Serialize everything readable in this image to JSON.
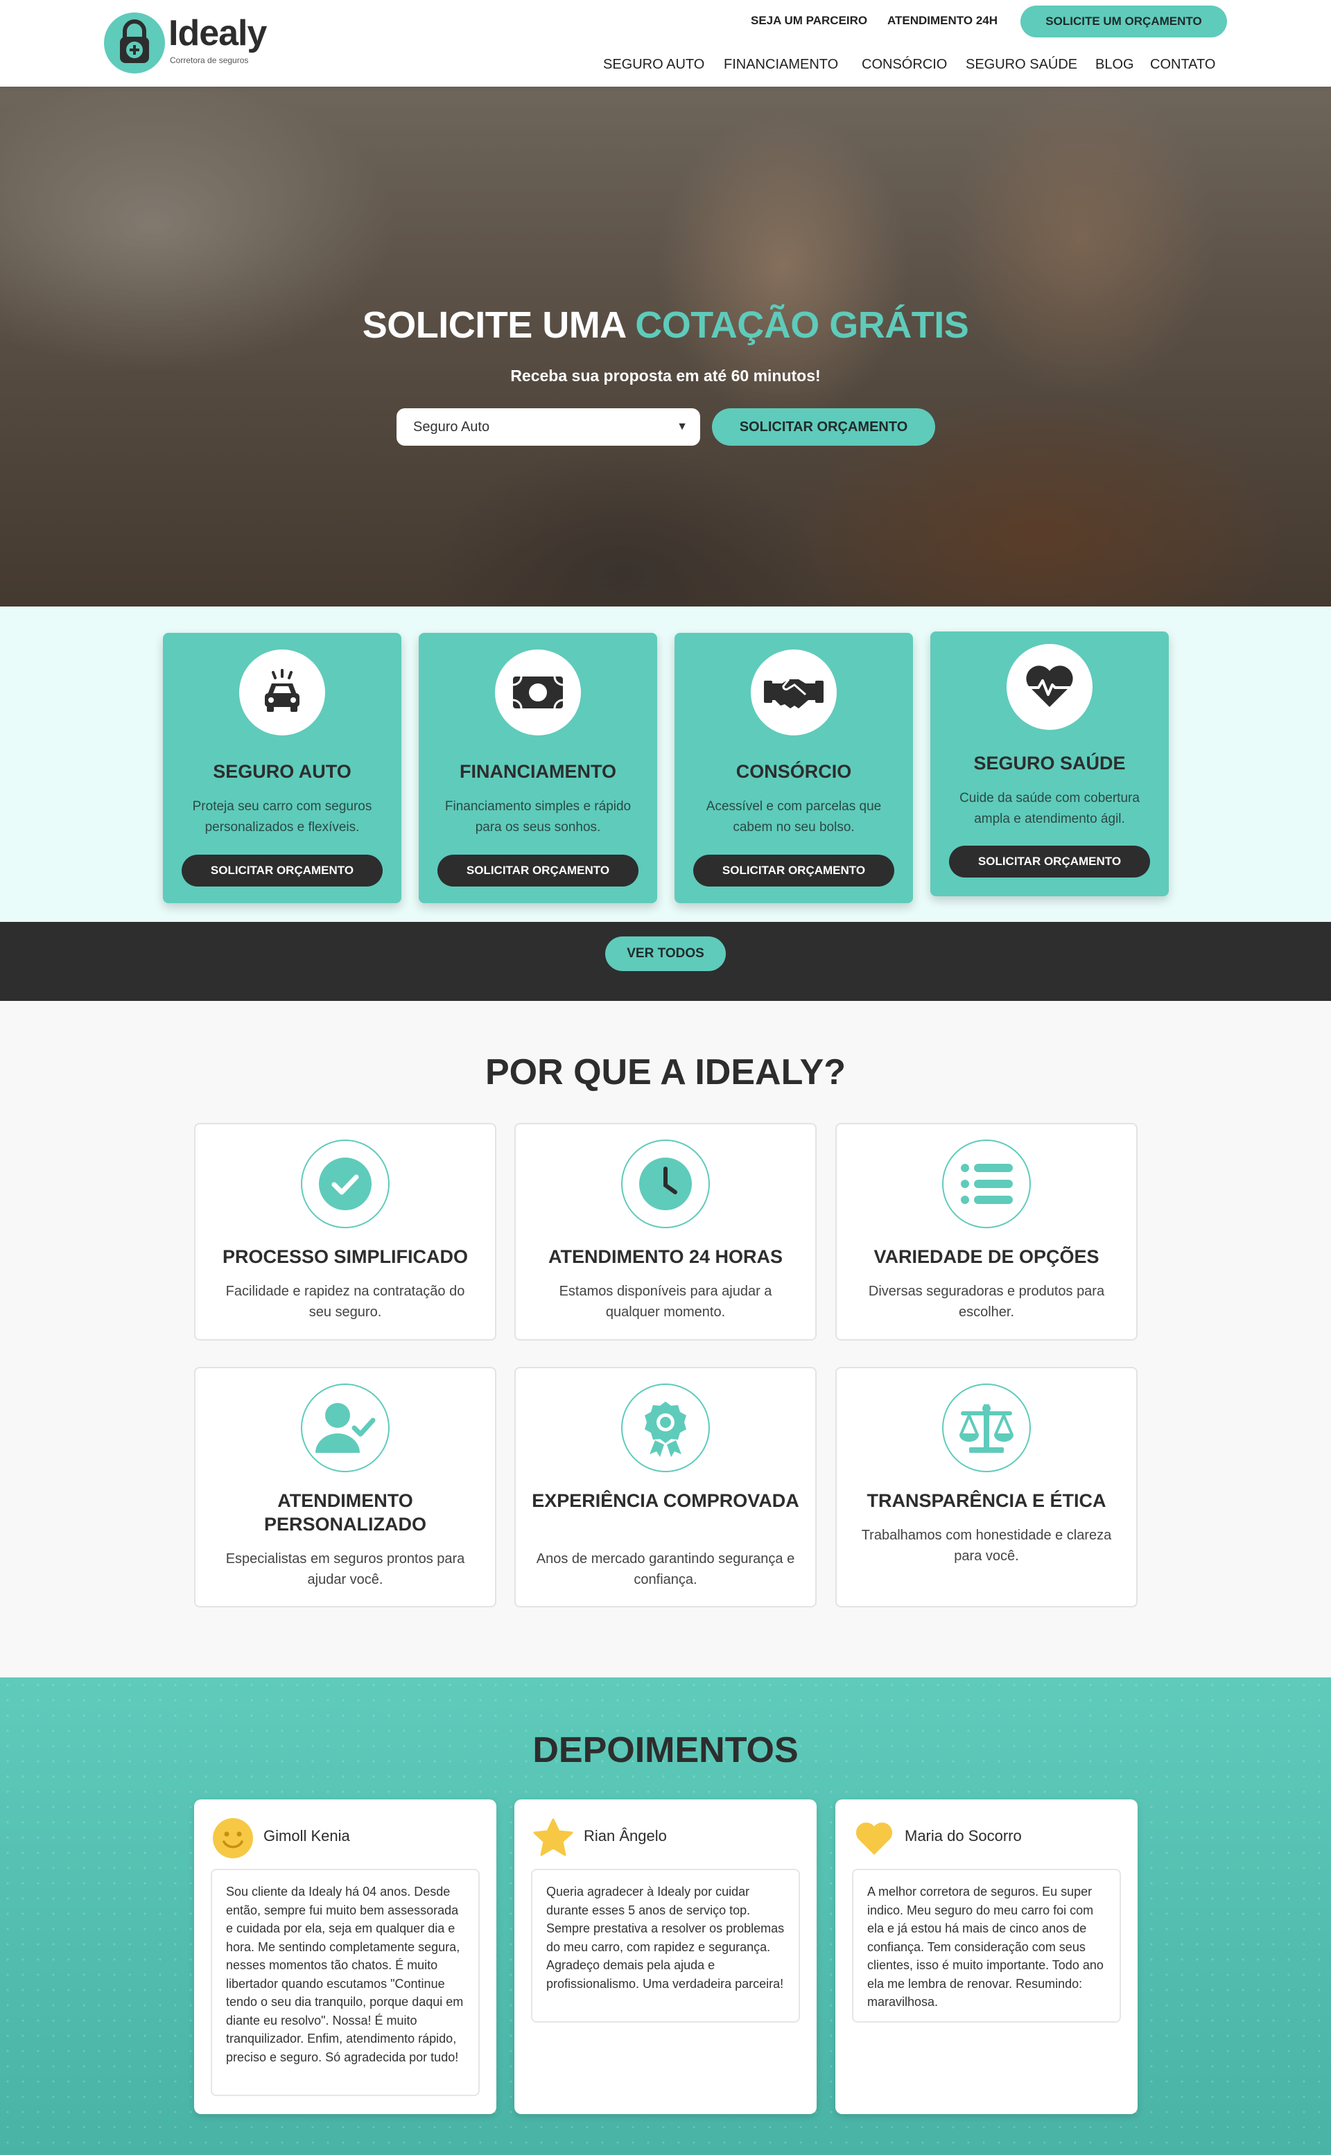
{
  "brand": {
    "name": "Idealy",
    "tagline": "Corretora de seguros"
  },
  "header": {
    "top_links": [
      "SEJA UM PARCEIRO",
      "ATENDIMENTO 24H"
    ],
    "cta_label": "SOLICITE UM ORÇAMENTO",
    "nav": [
      "SEGURO AUTO",
      "FINANCIAMENTO",
      "CONSÓRCIO",
      "SEGURO SAÚDE",
      "BLOG",
      "CONTATO"
    ]
  },
  "hero": {
    "title_part1": "SOLICITE UMA ",
    "title_accent": "COTAÇÃO GRÁTIS",
    "subtitle": "Receba sua proposta em até 60 minutos!",
    "select_value": "Seguro Auto",
    "button_label": "SOLICITAR ORÇAMENTO"
  },
  "services": {
    "items": [
      {
        "title": "SEGURO AUTO",
        "desc": "Proteja seu carro com seguros personalizados e flexíveis.",
        "button": "SOLICITAR ORÇAMENTO",
        "icon": "car-icon"
      },
      {
        "title": "FINANCIAMENTO",
        "desc": "Financiamento simples e rápido para os seus sonhos.",
        "button": "SOLICITAR ORÇAMENTO",
        "icon": "money-bill-icon"
      },
      {
        "title": "CONSÓRCIO",
        "desc": "Acessível e com parcelas que cabem no seu bolso.",
        "button": "SOLICITAR ORÇAMENTO",
        "icon": "handshake-icon"
      },
      {
        "title": "SEGURO SAÚDE",
        "desc": "Cuide da saúde com cobertura ampla e atendimento ágil.",
        "button": "SOLICITAR ORÇAMENTO",
        "icon": "heart-pulse-icon"
      }
    ],
    "see_all_label": "VER TODOS"
  },
  "why": {
    "title": "POR QUE A IDEALY?",
    "items": [
      {
        "title": "PROCESSO SIMPLIFICADO",
        "desc": "Facilidade e rapidez na contratação do seu seguro.",
        "icon": "check-circle-icon"
      },
      {
        "title": "ATENDIMENTO 24 HORAS",
        "desc": "Estamos disponíveis para ajudar a qualquer momento.",
        "icon": "clock-icon"
      },
      {
        "title": "VARIEDADE DE OPÇÕES",
        "desc": "Diversas seguradoras e produtos para escolher.",
        "icon": "list-icon"
      },
      {
        "title": "ATENDIMENTO PERSONALIZADO",
        "desc": "Especialistas em seguros prontos para ajudar você.",
        "icon": "user-check-icon"
      },
      {
        "title": "EXPERIÊNCIA COMPROVADA",
        "desc": "Anos de mercado garantindo segurança e confiança.",
        "icon": "award-icon"
      },
      {
        "title": "TRANSPARÊNCIA E ÉTICA",
        "desc": "Trabalhamos com honestidade e clareza para você.",
        "icon": "scale-icon"
      }
    ]
  },
  "testimonials": {
    "title": "DEPOIMENTOS",
    "items": [
      {
        "name": "Gimoll Kenia",
        "icon": "smile-icon",
        "text": "Sou cliente da Idealy há 04 anos. Desde então, sempre fui muito bem assessorada e cuidada por ela, seja em qualquer dia e hora. Me sentindo completamente segura, nesses momentos tão chatos. É muito libertador quando escutamos \"Continue tendo o seu dia tranquilo, porque daqui em diante eu resolvo\". Nossa! É muito tranquilizador. Enfim, atendimento rápido, preciso e seguro. Só agradecida por tudo!"
      },
      {
        "name": "Rian Ângelo",
        "icon": "star-icon",
        "text": "Queria agradecer à Idealy por cuidar durante esses 5 anos de serviço top. Sempre prestativa a resolver os problemas do meu carro, com rapidez e segurança. Agradeço demais pela ajuda e profissionalismo. Uma verdadeira parceira!"
      },
      {
        "name": "Maria do Socorro",
        "icon": "heart-icon",
        "text": "A melhor corretora de seguros. Eu super indico. Meu seguro do meu carro foi com ela e já estou há mais de cinco anos de confiança. Tem consideração com seus clientes, isso é muito importante. Todo ano ela me lembra de renovar. Resumindo: maravilhosa."
      }
    ]
  },
  "colors": {
    "accent": "#5fcbbb",
    "dark": "#2d2d2d",
    "icon_yellow": "#f7c843"
  }
}
